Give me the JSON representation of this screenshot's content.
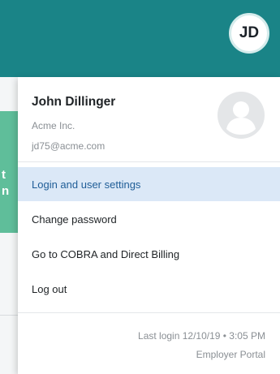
{
  "header": {
    "avatar_initials": "JD"
  },
  "background": {
    "card_text_line1": "t",
    "card_text_line2": "n"
  },
  "profile": {
    "name": "John Dillinger",
    "company": "Acme Inc.",
    "email": "jd75@acme.com"
  },
  "menu": {
    "items": [
      {
        "label": "Login and user settings",
        "active": true
      },
      {
        "label": "Change password",
        "active": false
      },
      {
        "label": "Go to COBRA and Direct Billing",
        "active": false
      },
      {
        "label": "Log out",
        "active": false
      }
    ]
  },
  "footer": {
    "last_login": "Last login 12/10/19 • 3:05 PM",
    "portal": "Employer Portal"
  },
  "colors": {
    "header_bg": "#1a8487",
    "active_item_bg": "#dbe8f7",
    "active_item_text": "#1f5d97",
    "background_card": "#5fbe9a"
  }
}
